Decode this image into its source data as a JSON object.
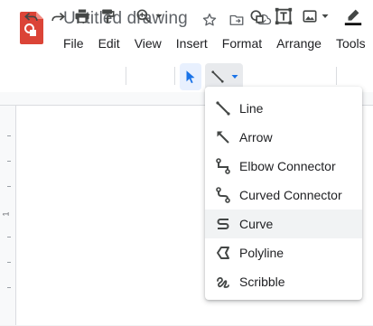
{
  "document": {
    "title": "Untitled drawing"
  },
  "menubar": [
    "File",
    "Edit",
    "View",
    "Insert",
    "Format",
    "Arrange",
    "Tools"
  ],
  "ruler": {
    "left_number": "1"
  },
  "line_menu": {
    "items": [
      {
        "label": "Line",
        "icon": "line-icon"
      },
      {
        "label": "Arrow",
        "icon": "arrow-icon"
      },
      {
        "label": "Elbow Connector",
        "icon": "elbow-connector-icon"
      },
      {
        "label": "Curved Connector",
        "icon": "curved-connector-icon"
      },
      {
        "label": "Curve",
        "icon": "curve-icon",
        "highlighted": true
      },
      {
        "label": "Polyline",
        "icon": "polyline-icon"
      },
      {
        "label": "Scribble",
        "icon": "scribble-icon"
      }
    ]
  },
  "colors": {
    "brand_red": "#db4437",
    "select_active_blue": "#1a73e8",
    "menu_hover": "#f1f3f4",
    "icon_gray": "#5f6368"
  },
  "icons": {
    "title_bar": [
      "star-icon",
      "move-to-folder-icon",
      "cloud-status-icon"
    ],
    "toolbar": [
      "undo-icon",
      "redo-icon",
      "print-icon",
      "paint-format-icon",
      "zoom-icon",
      "select-icon",
      "line-icon",
      "shape-icon",
      "text-box-icon",
      "image-icon",
      "line-color-icon"
    ]
  }
}
